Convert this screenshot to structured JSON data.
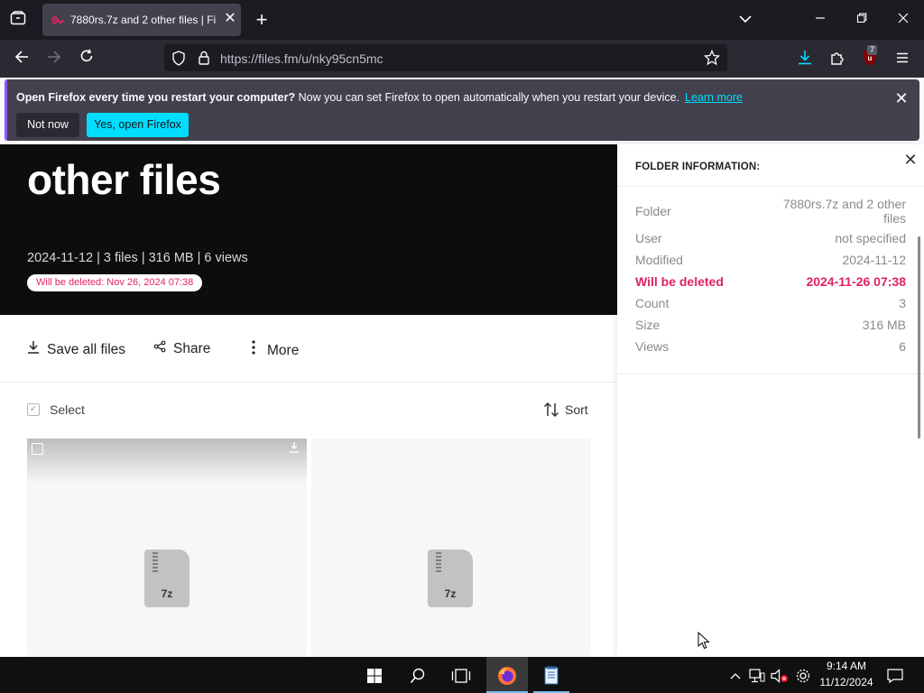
{
  "browser": {
    "tab_title": "7880rs.7z and 2 other files | Files.fm",
    "url": "https://files.fm/u/nky95cn5mc",
    "extension_badge": "7"
  },
  "notification": {
    "bold_text": "Open Firefox every time you restart your computer?",
    "text": " Now you can set Firefox to open automatically when you restart your device.",
    "link": "Learn more",
    "not_now": "Not now",
    "yes_open": "Yes, open Firefox"
  },
  "hero": {
    "title": "other files",
    "meta": "2024-11-12 | 3 files | 316 MB | 6 views",
    "deletion_badge": "Will be deleted: Nov 26, 2024 07:38"
  },
  "actions": {
    "save_all": "Save all files",
    "share": "Share",
    "more": "More"
  },
  "list": {
    "select_label": "Select",
    "sort_label": "Sort",
    "files": [
      {
        "ext": "7z"
      },
      {
        "ext": "7z"
      }
    ]
  },
  "panel": {
    "title": "FOLDER INFORMATION:",
    "rows": [
      {
        "label": "Folder",
        "value": "7880rs.7z and 2 other files"
      },
      {
        "label": "User",
        "value": "not specified"
      },
      {
        "label": "Modified",
        "value": "2024-11-12"
      },
      {
        "label": "Will be deleted",
        "value": "2024-11-26 07:38"
      },
      {
        "label": "Count",
        "value": "3"
      },
      {
        "label": "Size",
        "value": "316 MB"
      },
      {
        "label": "Views",
        "value": "6"
      }
    ]
  },
  "taskbar": {
    "time": "9:14 AM",
    "date": "11/12/2024"
  },
  "colors": {
    "firefox_dark": "#1c1b22",
    "toolbar": "#2b2a33",
    "accent_cyan": "#00ddff",
    "danger": "#e0245e"
  }
}
